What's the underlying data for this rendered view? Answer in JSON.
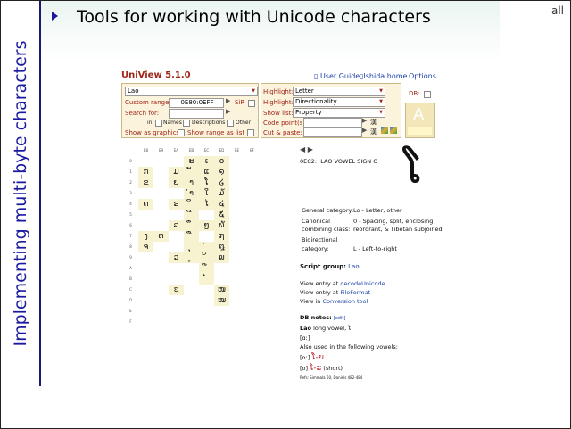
{
  "slide": {
    "vertical_title": "Implementing multi-byte characters",
    "title": "Tools for working with Unicode characters",
    "corner_label": "all"
  },
  "app": {
    "title": "UniView 5.1.0",
    "links": {
      "user_guide": "User Guide",
      "ishida_home": "Ishida home",
      "options": "Options"
    },
    "block_select": "Lao",
    "custom_range_label": "Custom range:",
    "custom_range_value": "0E80:0EFF",
    "sir_label": "SiR",
    "search_for_label": "Search for:",
    "in_label": "in",
    "names_label": "Names",
    "descriptions_label": "Descriptions",
    "other_label": "Other",
    "show_as_graphics_label": "Show as graphics",
    "show_range_as_list_label": "Show range as list",
    "highlight_label": "Highlight:",
    "highlight_value1": "Letter",
    "highlight_value2": "Directionality",
    "show_list_label": "Show list:",
    "show_list_value": "Property",
    "code_points_label": "Code point(s):",
    "cut_paste_label": "Cut & paste:",
    "db_label": "DB:",
    "sample_char": "A",
    "grid": {
      "col_headers": [
        "E8",
        "E9",
        "EA",
        "EB",
        "EC",
        "ED",
        "EE",
        "EF"
      ],
      "row_headers": [
        "0",
        "1",
        "2",
        "3",
        "4",
        "5",
        "6",
        "7",
        "8",
        "9",
        "A",
        "B",
        "C",
        "D",
        "E",
        "F"
      ],
      "rows": [
        [
          "",
          "",
          "",
          "ະ",
          "ເ",
          "໐",
          "",
          ""
        ],
        [
          "ກ",
          "",
          "ມ",
          "ັ",
          "ແ",
          "໑",
          "",
          ""
        ],
        [
          "ຂ",
          "",
          "ຢ",
          "າ",
          "ໂ",
          "໒",
          "",
          ""
        ],
        [
          "",
          "",
          "",
          "ຳ",
          "ໃ",
          "໓",
          "",
          ""
        ],
        [
          "ຄ",
          "",
          "ຣ",
          "ິ",
          "ໄ",
          "໔",
          "",
          ""
        ],
        [
          "",
          "",
          "",
          "ີ",
          "",
          "໕",
          "",
          ""
        ],
        [
          "",
          "",
          "ລ",
          "ຶ",
          "ໆ",
          "໖",
          "",
          ""
        ],
        [
          "ງ",
          "ທ",
          "",
          "ື",
          "",
          "໗",
          "",
          ""
        ],
        [
          "ຈ",
          "",
          "",
          "ຸ",
          "່",
          "໘",
          "",
          ""
        ],
        [
          "",
          "",
          "ວ",
          "ູ",
          "້",
          "໙",
          "",
          ""
        ],
        [
          "",
          "",
          "",
          "",
          "໊",
          "",
          "",
          ""
        ],
        [
          "",
          "",
          "",
          "",
          "໋",
          "",
          "",
          ""
        ],
        [
          "",
          "",
          "ຬ",
          "",
          "",
          "ໜ",
          "",
          ""
        ],
        [
          "",
          "",
          "",
          "",
          "",
          "ໝ",
          "",
          ""
        ],
        [
          "",
          "",
          "",
          "",
          "",
          "",
          "",
          ""
        ],
        [
          "",
          "",
          "",
          "",
          "",
          "",
          "",
          ""
        ]
      ]
    },
    "detail": {
      "code": "0EC2:",
      "name": "LAO VOWEL SIGN O",
      "glyph": "ໂ",
      "general_category_label": "General category:",
      "general_category_value": "Lo - Letter, other",
      "canonical_label_1": "Canonical",
      "canonical_label_2": "combining class:",
      "canonical_value_1": "0 - Spacing, split, enclosing,",
      "canonical_value_2": "reordrant, & Tibetan subjoined",
      "bidi_label_1": "Bidirectional",
      "bidi_label_2": "category:",
      "bidi_value": "L - Left-to-right",
      "script_group_label": "Script group:",
      "script_group_value": "Lao",
      "view_entry_at": "View entry at",
      "decode_unicode": "decodeUnicode",
      "file_format": "FileFormat",
      "view_in": "View in",
      "conversion_tool": "Conversion tool",
      "db_notes_label": "DB notes:",
      "edit_label": "[edit]",
      "note_lao": "Lao",
      "note_rest": "long vowel,",
      "note_ipa1": "[ɑː]",
      "note_also": "Also used in the following vowels:",
      "note_ipa2": "[oː]",
      "note_lao2": "ໂ-ຍ",
      "note_ipa3": "[o]",
      "note_lao3": "ໂ-ະ",
      "note_short": "(short)",
      "refs": "Refs: Simmala 60, Daniels 482-484"
    }
  }
}
